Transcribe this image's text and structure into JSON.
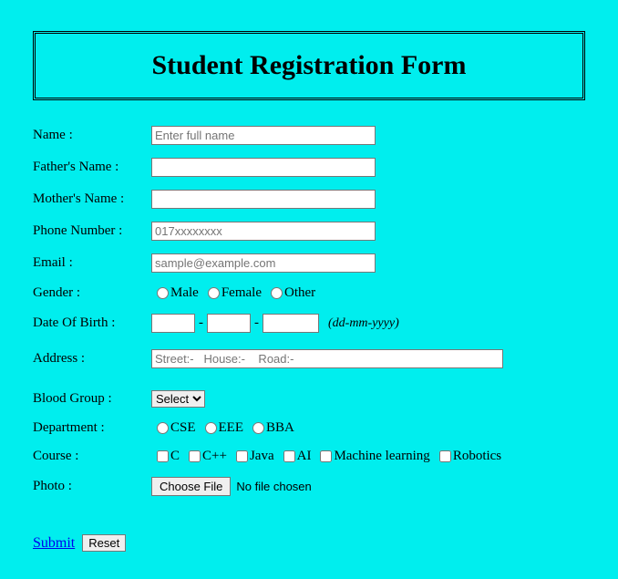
{
  "header": {
    "title": "Student Registration Form"
  },
  "labels": {
    "name": "Name :",
    "father": "Father's Name :",
    "mother": "Mother's Name :",
    "phone": "Phone Number :",
    "email": "Email :",
    "gender": "Gender :",
    "dob": "Date Of Birth :",
    "address": "Address :",
    "blood": "Blood Group :",
    "dept": "Department :",
    "course": "Course :",
    "photo": "Photo :"
  },
  "placeholders": {
    "name": "Enter full name",
    "phone": "017xxxxxxxx",
    "email": "sample@example.com",
    "address": "Street:-   House:-    Road:-"
  },
  "gender_options": {
    "male": "Male",
    "female": "Female",
    "other": "Other"
  },
  "dob": {
    "sep": "-",
    "hint": "(dd-mm-yyyy)"
  },
  "blood": {
    "selected": "Select"
  },
  "dept_options": {
    "cse": "CSE",
    "eee": "EEE",
    "bba": "BBA"
  },
  "course_options": {
    "c": "C",
    "cpp": "C++",
    "java": "Java",
    "ai": "AI",
    "ml": "Machine learning",
    "robotics": "Robotics"
  },
  "photo": {
    "button": "Choose File",
    "status": "No file chosen"
  },
  "actions": {
    "submit": "Submit",
    "reset": "Reset"
  }
}
